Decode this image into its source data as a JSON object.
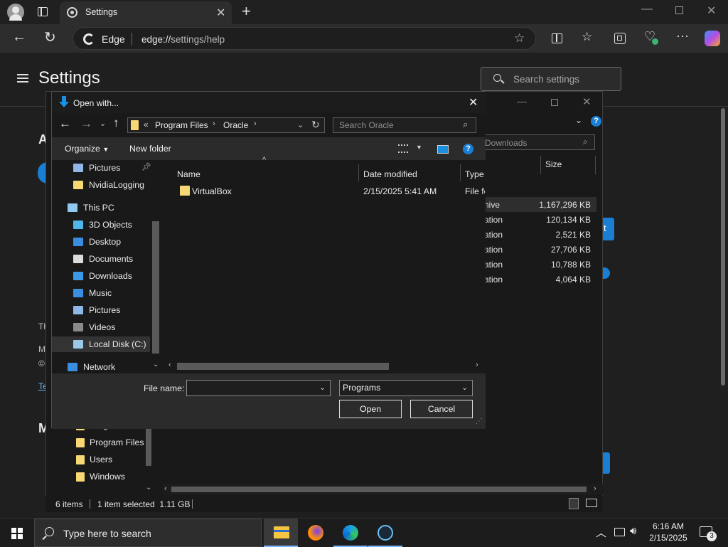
{
  "browser": {
    "tab_title": "Settings",
    "edge_label": "Edge",
    "url_prefix": "edge://",
    "url_path": "settings/help"
  },
  "settings": {
    "title": "Settings",
    "search_placeholder": "Search settings"
  },
  "downloads_window": {
    "search_placeholder": "Downloads",
    "size_header": "Size",
    "rows": [
      {
        "type": "hive",
        "size": "1,167,296 KB"
      },
      {
        "type": "ation",
        "size": "120,134 KB"
      },
      {
        "type": "ation",
        "size": "2,521 KB"
      },
      {
        "type": "ation",
        "size": "27,706 KB"
      },
      {
        "type": "ation",
        "size": "10,788 KB"
      },
      {
        "type": "ation",
        "size": "4,064 KB"
      }
    ],
    "tree_tail": [
      "Program Files",
      "Program Files (",
      "Users",
      "Windows"
    ]
  },
  "dialog": {
    "title": "Open with...",
    "breadcrumb": [
      "Program Files",
      "Oracle"
    ],
    "breadcrumb_prefix": "«",
    "search_placeholder": "Search Oracle",
    "toolbar": {
      "organize": "Organize",
      "new_folder": "New folder"
    },
    "nav_items": [
      {
        "label": "Pictures",
        "icon": "pictures-icon",
        "pinned": true
      },
      {
        "label": "NvidiaLogging",
        "icon": "folder-icon"
      },
      {
        "label": "This PC",
        "icon": "computer-icon"
      },
      {
        "label": "3D Objects",
        "icon": "3d-objects-icon"
      },
      {
        "label": "Desktop",
        "icon": "desktop-icon"
      },
      {
        "label": "Documents",
        "icon": "documents-icon"
      },
      {
        "label": "Downloads",
        "icon": "downloads-icon"
      },
      {
        "label": "Music",
        "icon": "music-icon"
      },
      {
        "label": "Pictures",
        "icon": "pictures-icon"
      },
      {
        "label": "Videos",
        "icon": "videos-icon"
      },
      {
        "label": "Local Disk (C:)",
        "icon": "disk-icon",
        "selected": true
      },
      {
        "label": "Network",
        "icon": "network-icon"
      }
    ],
    "columns": {
      "name": "Name",
      "date": "Date modified",
      "type": "Type"
    },
    "files": [
      {
        "name": "VirtualBox",
        "date": "2/15/2025 5:41 AM",
        "type": "File fo"
      }
    ],
    "file_name_label": "File name:",
    "file_name_value": "",
    "filter_value": "Programs",
    "open_label": "Open",
    "cancel_label": "Cancel"
  },
  "statusbar": {
    "items": "6 items",
    "selected": "1 item selected  1.11 GB"
  },
  "taskbar": {
    "search_text": "Type here to search",
    "time": "6:16 AM",
    "date": "2/15/2025",
    "notification_count": "3"
  },
  "colors": {
    "accent": "#0078d4",
    "folder": "#f8d775",
    "background": "#1f1f1f"
  }
}
